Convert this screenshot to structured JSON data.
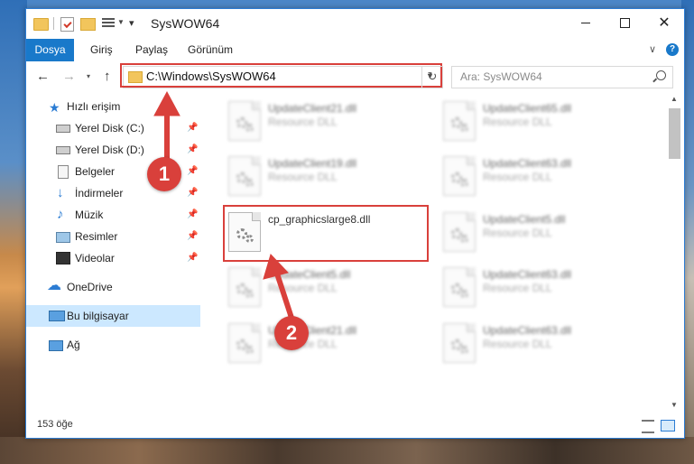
{
  "window": {
    "title": "SysWOW64",
    "minimize_icon": "minimize-icon",
    "maximize_icon": "maximize-icon",
    "close_glyph": "✕"
  },
  "ribbon": {
    "tabs": [
      "Dosya",
      "Giriş",
      "Paylaş",
      "Görünüm"
    ],
    "help": "?"
  },
  "navigation": {
    "back": "←",
    "forward": "→",
    "recent": "▾",
    "up": "↑",
    "address": "C:\\Windows\\SysWOW64",
    "dropdown": "▼",
    "refresh": "↻",
    "search_placeholder": "Ara: SysWOW64"
  },
  "sidebar": {
    "items": [
      {
        "label": "Hızlı erişim",
        "icon": "star-icon",
        "pinned": false
      },
      {
        "label": "Yerel Disk (C:)",
        "icon": "disk-icon",
        "pinned": true
      },
      {
        "label": "Yerel Disk (D:)",
        "icon": "disk-icon",
        "pinned": true
      },
      {
        "label": "Belgeler",
        "icon": "documents-icon",
        "pinned": true
      },
      {
        "label": "İndirmeler",
        "icon": "downloads-icon",
        "pinned": true
      },
      {
        "label": "Müzik",
        "icon": "music-icon",
        "pinned": true
      },
      {
        "label": "Resimler",
        "icon": "pictures-icon",
        "pinned": true
      },
      {
        "label": "Videolar",
        "icon": "videos-icon",
        "pinned": true
      },
      {
        "label": "OneDrive",
        "icon": "onedrive-icon",
        "pinned": false
      },
      {
        "label": "Bu bilgisayar",
        "icon": "computer-icon",
        "pinned": false,
        "selected": true
      },
      {
        "label": "Ağ",
        "icon": "network-icon",
        "pinned": false
      }
    ],
    "pin_glyph": "📌"
  },
  "files": [
    {
      "name": "UpdateClient21.dll",
      "type": "Resource DLL",
      "blurred": true
    },
    {
      "name": "UpdateClient65.dll",
      "type": "Resource DLL",
      "blurred": true
    },
    {
      "name": "UpdateClient19.dll",
      "type": "Resource DLL",
      "blurred": true
    },
    {
      "name": "UpdateClient63.dll",
      "type": "Resource DLL",
      "blurred": true
    },
    {
      "name": "cp_graphicslarge8.dll",
      "type": "",
      "blurred": false,
      "highlighted": true
    },
    {
      "name": "UpdateClient5.dll",
      "type": "Resource DLL",
      "blurred": true
    },
    {
      "name": "UpdateClient5.dll",
      "type": "Resource DLL",
      "blurred": true
    },
    {
      "name": "UpdateClient63.dll",
      "type": "Resource DLL",
      "blurred": true
    },
    {
      "name": "UpdateClient21.dll",
      "type": "Resource DLL",
      "blurred": true
    },
    {
      "name": "UpdateClient63.dll",
      "type": "Resource DLL",
      "blurred": true
    }
  ],
  "status": {
    "item_count": "153 öğe"
  },
  "annotations": {
    "markers": [
      "1",
      "2"
    ],
    "color": "#d9403b"
  }
}
